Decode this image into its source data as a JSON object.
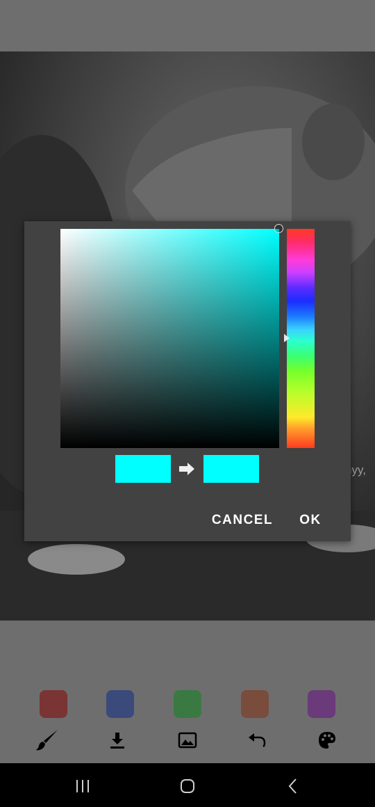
{
  "dialog": {
    "cancel_label": "CANCEL",
    "ok_label": "OK",
    "hue_color": "#00ffff",
    "old_color": "#00ffff",
    "new_color": "#00ffff"
  },
  "background": {
    "watermark_text": "nyy,"
  },
  "palette": [
    {
      "name": "red",
      "color": "#7a3434"
    },
    {
      "name": "blue",
      "color": "#3a4a7a"
    },
    {
      "name": "green",
      "color": "#3a7a42"
    },
    {
      "name": "brown",
      "color": "#7a4c3c"
    },
    {
      "name": "purple",
      "color": "#6a3a7a"
    }
  ],
  "toolbar": {
    "icons": [
      "brush-icon",
      "download-icon",
      "image-icon",
      "undo-icon",
      "palette-icon"
    ]
  },
  "navbar": {
    "icons": [
      "recent-apps-icon",
      "home-icon",
      "back-icon"
    ]
  }
}
